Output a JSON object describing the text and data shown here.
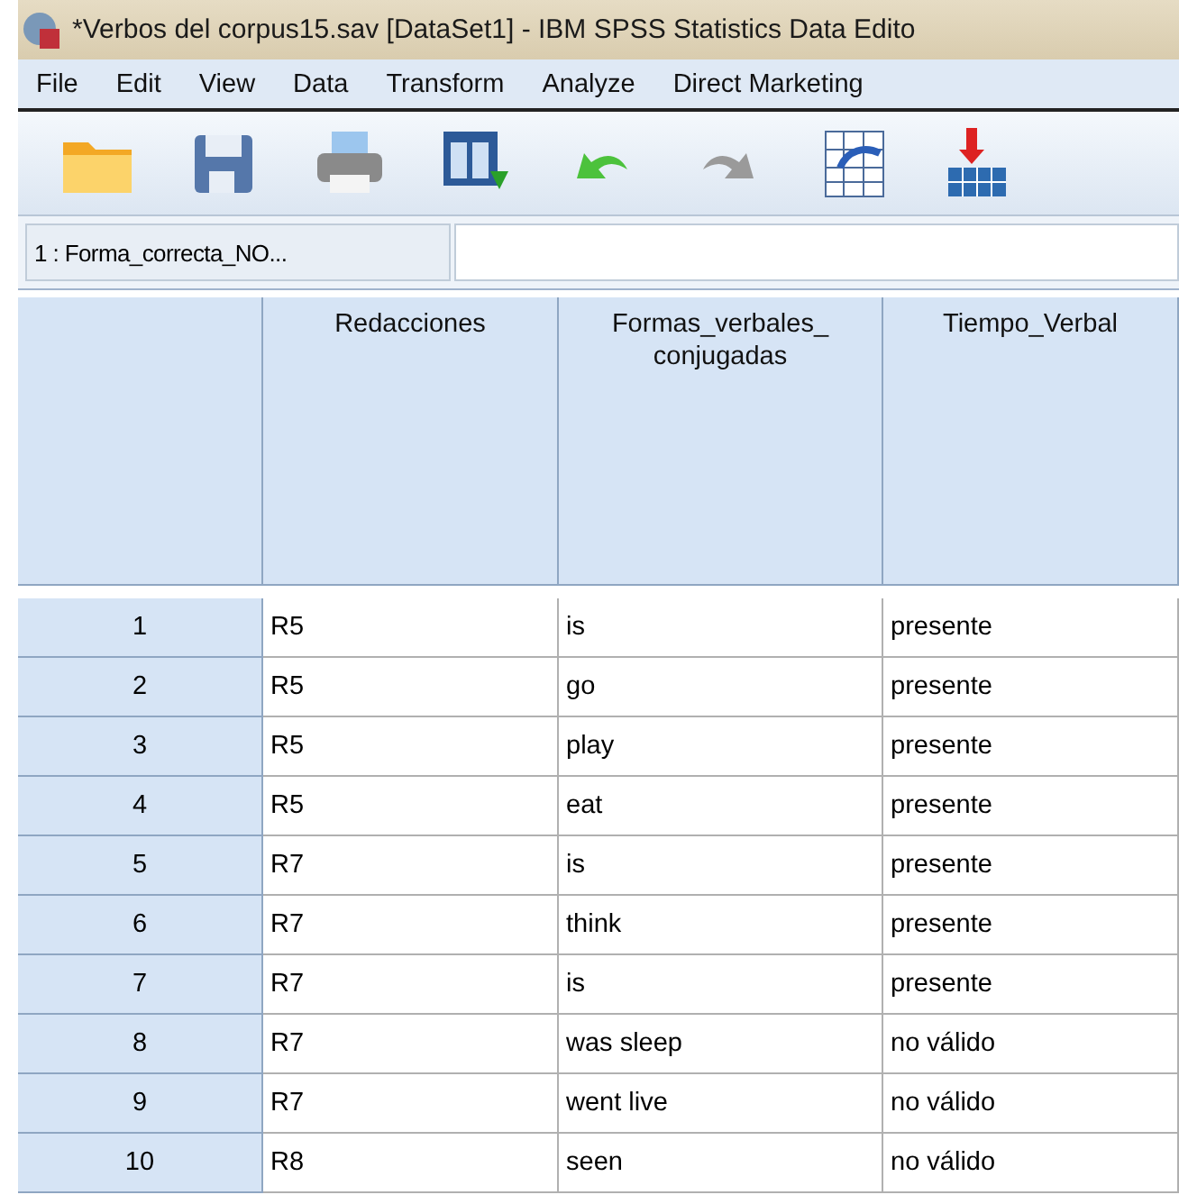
{
  "window": {
    "title": "*Verbos del corpus15.sav [DataSet1] - IBM SPSS Statistics Data Edito"
  },
  "menu": [
    "File",
    "Edit",
    "View",
    "Data",
    "Transform",
    "Analyze",
    "Direct Marketing"
  ],
  "cell_editor": {
    "label": "1 : Forma_correcta_NO..."
  },
  "table": {
    "columns": [
      "Redacciones",
      "Formas_verbales_ conjugadas",
      "Tiempo_Verbal"
    ],
    "rows": [
      {
        "number": "1",
        "cells": [
          "R5",
          "is",
          "presente"
        ]
      },
      {
        "number": "2",
        "cells": [
          "R5",
          "go",
          "presente"
        ]
      },
      {
        "number": "3",
        "cells": [
          "R5",
          "play",
          "presente"
        ]
      },
      {
        "number": "4",
        "cells": [
          "R5",
          "eat",
          "presente"
        ]
      },
      {
        "number": "5",
        "cells": [
          "R7",
          "is",
          "presente"
        ]
      },
      {
        "number": "6",
        "cells": [
          "R7",
          "think",
          "presente"
        ]
      },
      {
        "number": "7",
        "cells": [
          "R7",
          "is",
          "presente"
        ]
      },
      {
        "number": "8",
        "cells": [
          "R7",
          "was sleep",
          "no válido"
        ]
      },
      {
        "number": "9",
        "cells": [
          "R7",
          "went live",
          "no válido"
        ]
      },
      {
        "number": "10",
        "cells": [
          "R8",
          "seen",
          "no válido"
        ]
      }
    ]
  }
}
